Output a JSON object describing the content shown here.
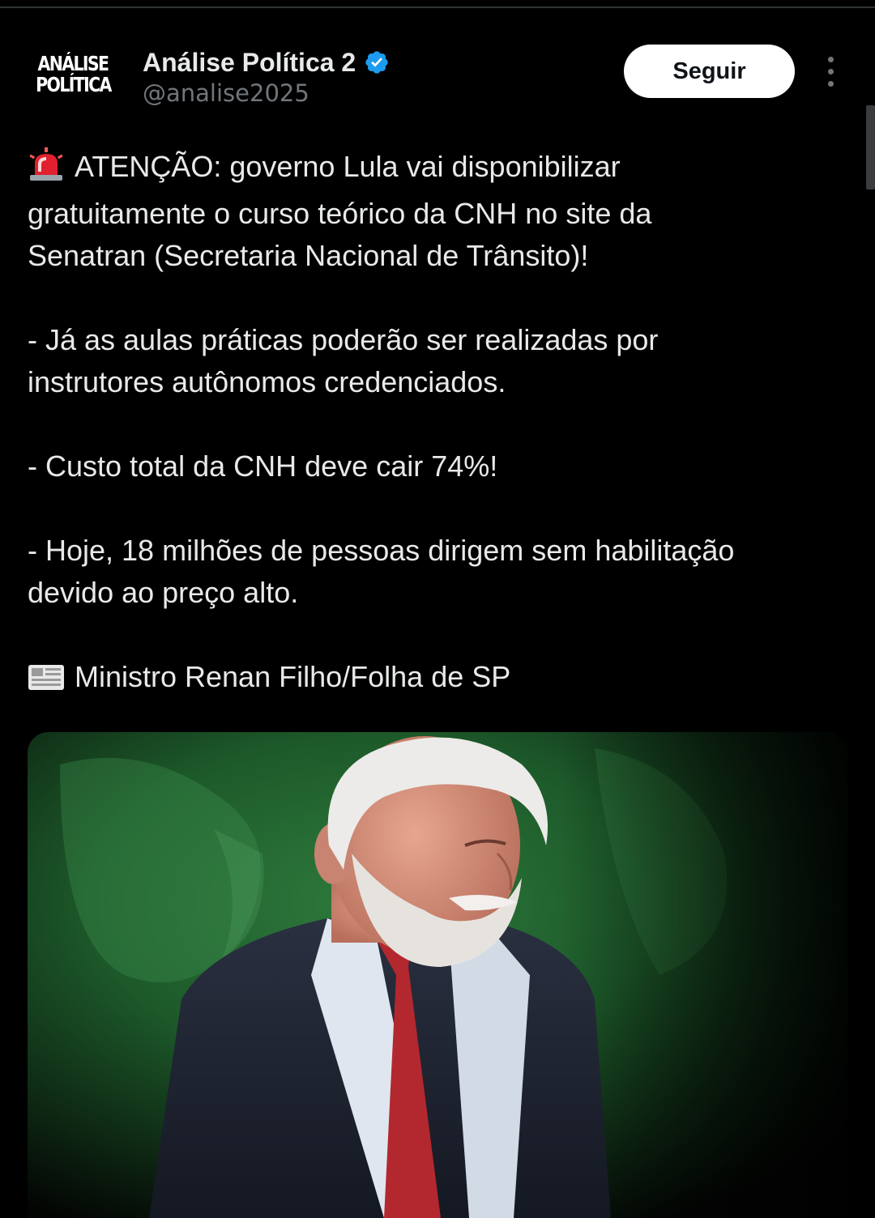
{
  "tweet": {
    "author": {
      "display_name": "Análise Política 2",
      "handle": "@analise2025",
      "avatar_logo_lines": [
        "ANÁLISE",
        "POLÍTICA"
      ],
      "verified_icon": "verified-badge-icon"
    },
    "follow_label": "Seguir",
    "more_icon": "more-options-icon",
    "paragraphs": [
      {
        "icon": "police-siren-emoji",
        "lines": [
          "ATENÇÃO: governo Lula vai disponibilizar",
          "gratuitamente o curso teórico da CNH no site da",
          "Senatran (Secretaria Nacional de Trânsito)!"
        ]
      },
      {
        "lines": [
          "- Já as aulas práticas poderão ser realizadas por",
          "instrutores autônomos credenciados."
        ]
      },
      {
        "lines": [
          "- Custo total da CNH deve cair 74%!"
        ]
      },
      {
        "lines": [
          "- Hoje, 18 milhões de pessoas dirigem sem habilitação",
          "devido ao preço alto."
        ]
      },
      {
        "icon": "newspaper-emoji",
        "lines": [
          "Ministro Renan Filho/Folha de SP"
        ]
      }
    ],
    "media": {
      "kind": "photo",
      "subject": "photo-of-man-in-suit"
    }
  },
  "colors": {
    "background": "#000000",
    "text": "#e7e9ea",
    "secondary_text": "#71767b",
    "verified_blue": "#1d9bf0",
    "follow_button_bg": "#ffffff"
  }
}
